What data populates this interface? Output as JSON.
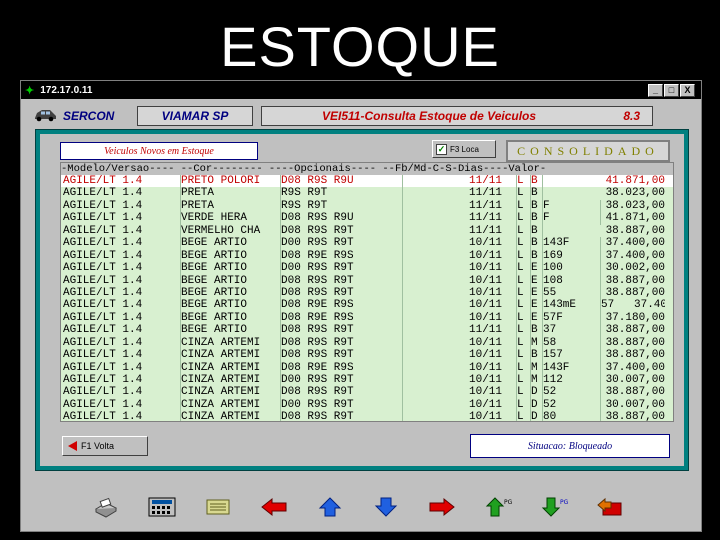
{
  "slide": {
    "title": "ESTOQUE"
  },
  "window": {
    "title": "172.17.0.11",
    "buttons": [
      "_",
      "□",
      "X"
    ]
  },
  "header": {
    "app_name": "SERCON",
    "store": "VIAMAR SP",
    "program": "VEI511-Consulta Estoque de Veiculos",
    "version": "8.3"
  },
  "panel": {
    "left_label": "Veiculos Novos em Estoque",
    "checkbox_label": "F3 Loca",
    "mode_label": "CONSOLIDADO"
  },
  "grid": {
    "header": "-Modelo/Versao---- --Cor-------- ----Opcionais---- --Fb/Md-C-S-Dias----Valor-",
    "columns": [
      "Modelo/Versao",
      "Cor",
      "Opcionais",
      "Fb/Md",
      "C",
      "S",
      "Dias",
      "Valor"
    ],
    "rows": [
      [
        "AGILE/LT 1.4",
        "PRETO POLORI",
        "D08 R9S R9U",
        "11/11",
        "L",
        "B",
        "",
        "41.871,00"
      ],
      [
        "AGILE/LT 1.4",
        "PRETA",
        "R9S R9T",
        "11/11",
        "L",
        "B",
        "",
        "38.023,00"
      ],
      [
        "AGILE/LT 1.4",
        "PRETA",
        "R9S R9T",
        "11/11",
        "L",
        "B",
        "F",
        "38.023,00"
      ],
      [
        "AGILE/LT 1.4",
        "VERDE HERA",
        "D08 R9S R9U",
        "11/11",
        "L",
        "B",
        "F",
        "41.871,00"
      ],
      [
        "AGILE/LT 1.4",
        "VERMELHO CHA",
        "D08 R9S R9T",
        "11/11",
        "L",
        "B",
        "",
        "38.887,00"
      ],
      [
        "AGILE/LT 1.4",
        "BEGE ARTIO",
        "D00 R9S R9T",
        "10/11",
        "L",
        "B",
        "143F",
        "37.400,00"
      ],
      [
        "AGILE/LT 1.4",
        "BEGE ARTIO",
        "D08 R9E R9S",
        "10/11",
        "L",
        "B",
        "169",
        "37.400,00"
      ],
      [
        "AGILE/LT 1.4",
        "BEGE ARTIO",
        "D00 R9S R9T",
        "10/11",
        "L",
        "E",
        "100",
        "30.002,00"
      ],
      [
        "AGILE/LT 1.4",
        "BEGE ARTIO",
        "D08 R9S R9T",
        "10/11",
        "L",
        "E",
        "108",
        "38.887,00"
      ],
      [
        "AGILE/LT 1.4",
        "BEGE ARTIO",
        "D08 R9S R9T",
        "10/11",
        "L",
        "E",
        "55",
        "38.887,00"
      ],
      [
        "AGILE/LT 1.4",
        "BEGE ARTIO",
        "D08 R9E R9S",
        "10/11",
        "L",
        "E",
        "143mE",
        "57   37.40"
      ],
      [
        "AGILE/LT 1.4",
        "BEGE ARTIO",
        "D08 R9E R9S",
        "10/11",
        "L",
        "E",
        "57F",
        "37.180,00"
      ],
      [
        "AGILE/LT 1.4",
        "BEGE ARTIO",
        "D08 R9S R9T",
        "11/11",
        "L",
        "B",
        "37",
        "38.887,00"
      ],
      [
        "AGILE/LT 1.4",
        "CINZA ARTEMI",
        "D08 R9S R9T",
        "10/11",
        "L",
        "M",
        "58",
        "38.887,00"
      ],
      [
        "AGILE/LT 1.4",
        "CINZA ARTEMI",
        "D08 R9S R9T",
        "10/11",
        "L",
        "B",
        "157",
        "38.887,00"
      ],
      [
        "AGILE/LT 1.4",
        "CINZA ARTEMI",
        "D08 R9E R9S",
        "10/11",
        "L",
        "M",
        "143F",
        "37.400,00"
      ],
      [
        "AGILE/LT 1.4",
        "CINZA ARTEMI",
        "D00 R9S R9T",
        "10/11",
        "L",
        "M",
        "112",
        "30.007,00"
      ],
      [
        "AGILE/LT 1.4",
        "CINZA ARTEMI",
        "D08 R9S R9T",
        "10/11",
        "L",
        "D",
        "52",
        "38.887,00"
      ],
      [
        "AGILE/LT 1.4",
        "CINZA ARTEMI",
        "D00 R9S R9T",
        "10/11",
        "L",
        "D",
        "52",
        "30.007,00"
      ],
      [
        "AGILE/LT 1.4",
        "CINZA ARTEMI",
        "D08 R9S R9T",
        "10/11",
        "L",
        "D",
        "80",
        "38.887,00"
      ]
    ]
  },
  "footer": {
    "back_button": "F1 Volta",
    "status": "Situacao: Bloqueado"
  },
  "toolbar": {
    "icons": [
      "print-icon",
      "calculator-icon",
      "notes-icon",
      "arrow-left-icon",
      "arrow-up-icon",
      "arrow-down-icon",
      "arrow-right-icon",
      "page-up-icon",
      "page-down-icon",
      "exit-icon"
    ]
  },
  "colors": {
    "selected_row_text": "#c00000",
    "grid_background": "#d8f0d0",
    "panel_border": "#008080"
  }
}
